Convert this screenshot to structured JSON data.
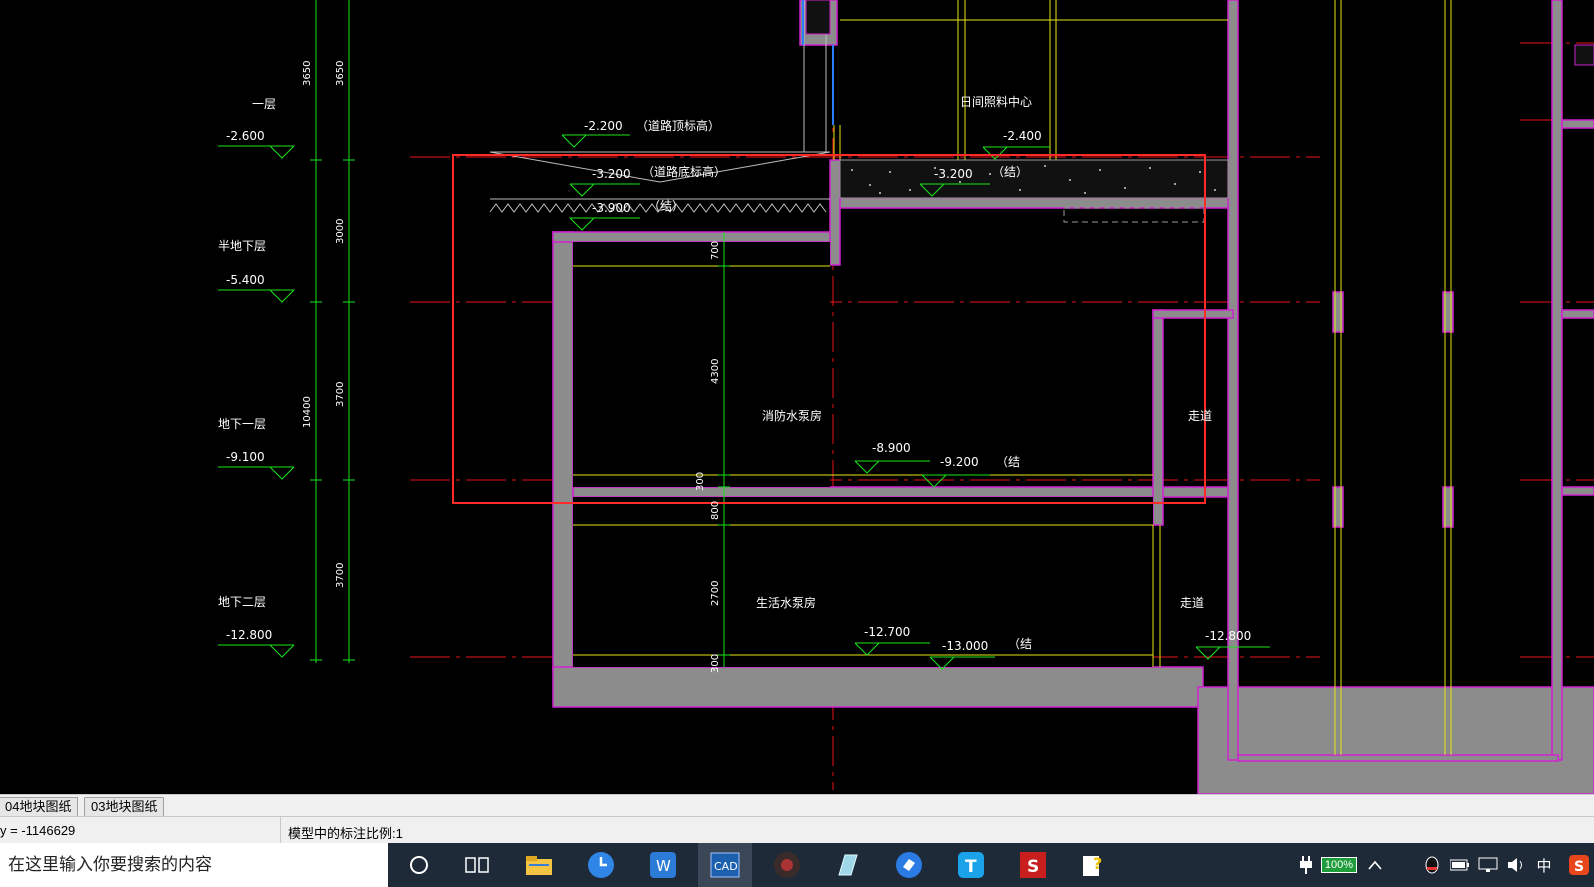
{
  "drawing": {
    "level_labels": [
      "一层",
      "半地下层",
      "地下一层",
      "地下二层"
    ],
    "left_elevations": [
      "-2.600",
      "-5.400",
      "-9.100",
      "-12.800"
    ],
    "dimensions": {
      "left_chain": [
        "3650",
        "3000",
        "3700",
        "3700"
      ],
      "total": "10400",
      "inner_chain": [
        "700",
        "4300",
        "300",
        "800",
        "2700",
        "300"
      ]
    },
    "road": {
      "top_elev": "-2.200",
      "top_note": "（道路顶标高）",
      "bottom_elev": "-3.200",
      "bottom_note": "（道路底标高）",
      "soil_elev": "-3.900",
      "soil_note": "（结）"
    },
    "rooms": {
      "fire_pump": "消防水泵房",
      "domestic_pump": "生活水泵房",
      "corridor_1": "走道",
      "corridor_2": "走道",
      "daycare": "日间照料中心"
    },
    "room_elevations": {
      "daycare_floor": "-2.400",
      "daycare_struct": "-3.200",
      "daycare_struct_note": "（结）",
      "fire_floor": "-8.900",
      "fire_struct": "-9.200",
      "fire_struct_note": "（结",
      "dom_floor": "-12.700",
      "dom_struct": "-13.000",
      "dom_struct_note": "（结",
      "corridor_floor": "-12.800"
    }
  },
  "layout_tabs": [
    "04地块图纸",
    "03地块图纸"
  ],
  "status": {
    "coords": "y = -1146629",
    "annotation_scale": "模型中的标注比例:1"
  },
  "taskbar": {
    "search_placeholder": "在这里输入你要搜索的内容",
    "battery": "100%",
    "ime": "中"
  }
}
